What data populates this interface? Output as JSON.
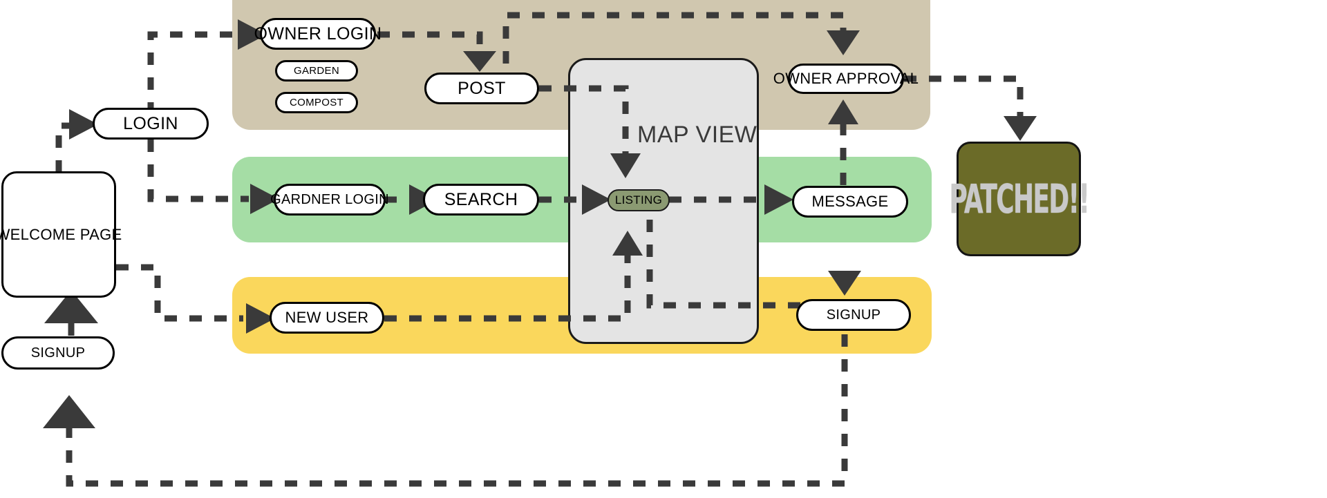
{
  "diagram": {
    "title": "MAP VIEW",
    "colors": {
      "lane_owner": "#d0c7af",
      "lane_gardner": "#a5dda5",
      "lane_newuser": "#fad75c",
      "panel": "#e4e4e4",
      "listing_fill": "#8b9a72",
      "patched_fill": "#6b6b28",
      "patched_text": "#c9c9c9",
      "stroke": "#000000",
      "connector": "#3a3a3a"
    },
    "lanes": [
      {
        "name": "owner-lane",
        "label": ""
      },
      {
        "name": "gardner-lane",
        "label": ""
      },
      {
        "name": "newuser-lane",
        "label": ""
      }
    ],
    "panel": {
      "label": "MAP VIEW"
    },
    "nodes": [
      {
        "id": "welcome-page",
        "label": "WELCOME PAGE"
      },
      {
        "id": "login",
        "label": "LOGIN"
      },
      {
        "id": "signup-left",
        "label": "SIGNUP"
      },
      {
        "id": "owner-login",
        "label": "OWNER  LOGIN"
      },
      {
        "id": "garden",
        "label": "GARDEN"
      },
      {
        "id": "compost",
        "label": "COMPOST"
      },
      {
        "id": "post",
        "label": "POST"
      },
      {
        "id": "owner-approval",
        "label": "OWNER APPROVAL"
      },
      {
        "id": "patched",
        "label": "PATCHED!!"
      },
      {
        "id": "gardner-login",
        "label": "GARDNER  LOGIN"
      },
      {
        "id": "search",
        "label": "SEARCH"
      },
      {
        "id": "listing",
        "label": "LISTING"
      },
      {
        "id": "message",
        "label": "MESSAGE"
      },
      {
        "id": "new-user",
        "label": "NEW USER"
      },
      {
        "id": "signup-right",
        "label": "SIGNUP"
      }
    ]
  }
}
